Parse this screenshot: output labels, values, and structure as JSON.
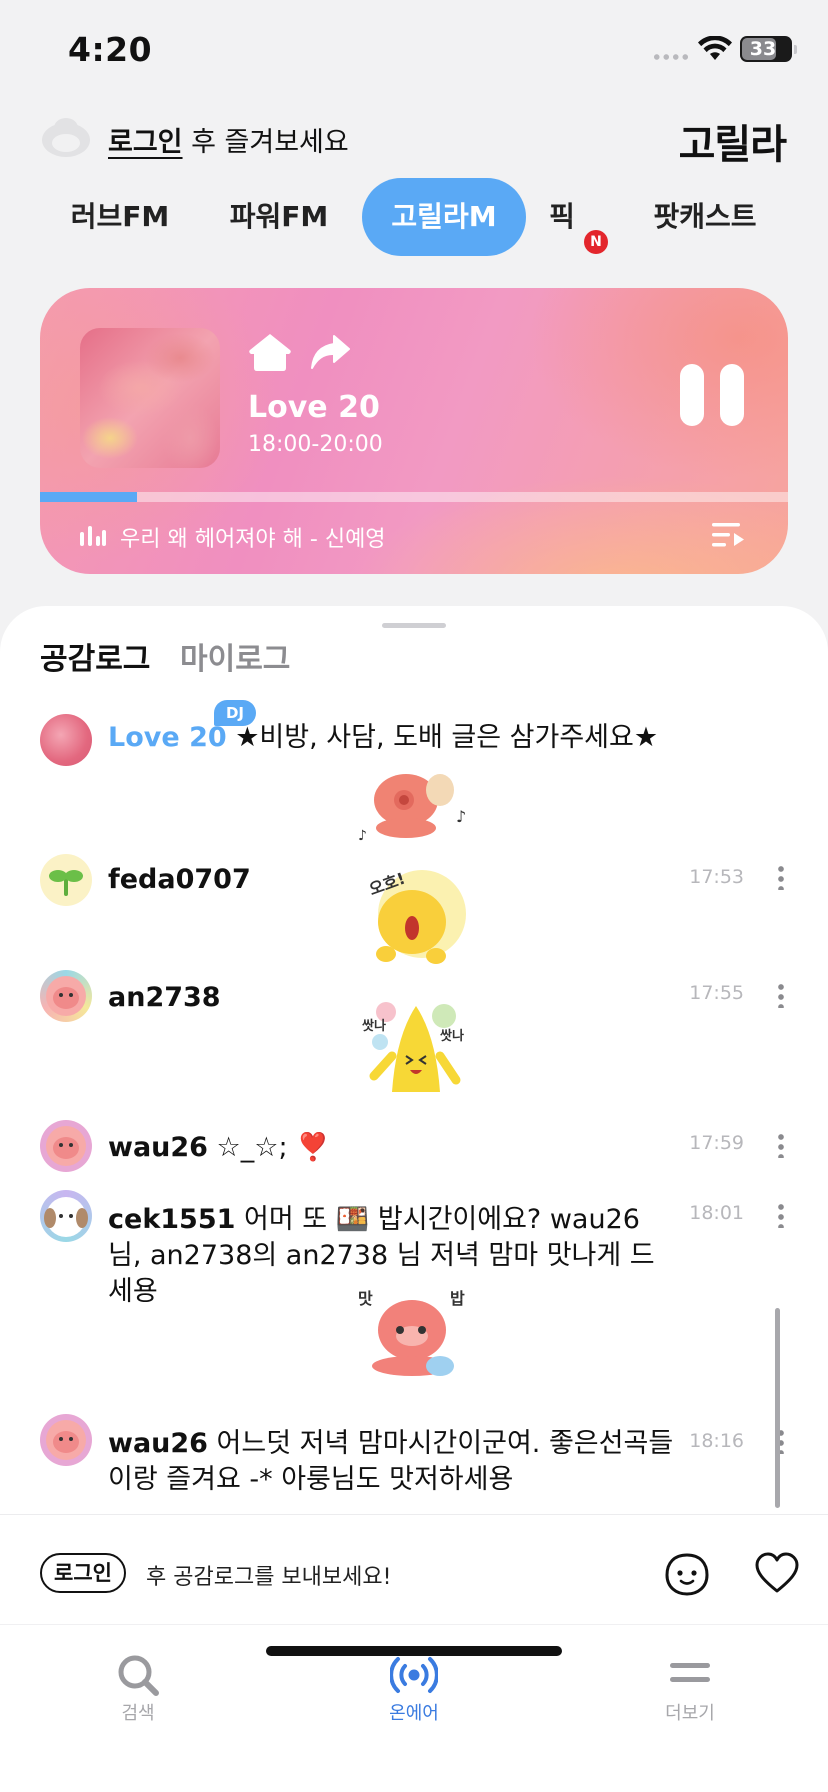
{
  "status": {
    "time": "4:20",
    "battery": "33"
  },
  "header": {
    "login_link": "로그인",
    "login_suffix": " 후 즐겨보세요",
    "brand": "고릴라"
  },
  "channel_tabs": [
    {
      "label": "러브FM",
      "active": false
    },
    {
      "label": "파워FM",
      "active": false
    },
    {
      "label": "고릴라M",
      "active": true
    },
    {
      "label": "픽",
      "active": false,
      "badge": "N"
    },
    {
      "label": "팟캐스트",
      "active": false
    }
  ],
  "player": {
    "program_title": "Love 20",
    "program_time": "18:00-20:00",
    "now_playing": "우리 왜 헤어져야 해 - 신예영",
    "progress": 0.13
  },
  "log_tabs": [
    {
      "label": "공감로그",
      "active": true
    },
    {
      "label": "마이로그",
      "active": false
    }
  ],
  "chat": {
    "dj": {
      "badge": "DJ",
      "name": "Love 20",
      "message": " ★비방, 사담, 도배 글은 삼가주세요★"
    },
    "messages": [
      {
        "user": "feda0707",
        "text": "",
        "time": "17:53",
        "sticker": "surprised-octopus-sticker"
      },
      {
        "user": "an2738",
        "text": "",
        "time": "17:55",
        "sticker": "dancing-banana-sticker"
      },
      {
        "user": "wau26",
        "text": " ☆_☆; ❣️",
        "time": "17:59"
      },
      {
        "user": "cek1551",
        "text": " 어머 또 🍱 밥시간이에요? wau26 님, an2738의 an2738 님 저녁 맘마 맛나게 드세용",
        "time": "18:01",
        "sticker": "eating-octopus-sticker",
        "sticker_text": [
          "맛",
          "밥"
        ]
      },
      {
        "user": "wau26",
        "text": " 어느덧 저녁 맘마시간이군여. 좋은선곡들이랑 즐겨요 -* 아룽님도 맛저하세용",
        "time": "18:16"
      }
    ],
    "sticker_text_feda": "오호!",
    "sticker_text_banana": [
      "쌋나",
      "쌋나"
    ]
  },
  "composer": {
    "login_chip": "로그인",
    "hint": "후 공감로그를 보내보세요!"
  },
  "bottom_nav": [
    {
      "label": "검색",
      "icon": "search-icon",
      "active": false
    },
    {
      "label": "온에어",
      "icon": "broadcast-icon",
      "active": true
    },
    {
      "label": "더보기",
      "icon": "menu-icon",
      "active": false
    }
  ],
  "colors": {
    "accent": "#5aa9f5",
    "active_nav": "#3a7be0",
    "badge_red": "#e3262c"
  }
}
